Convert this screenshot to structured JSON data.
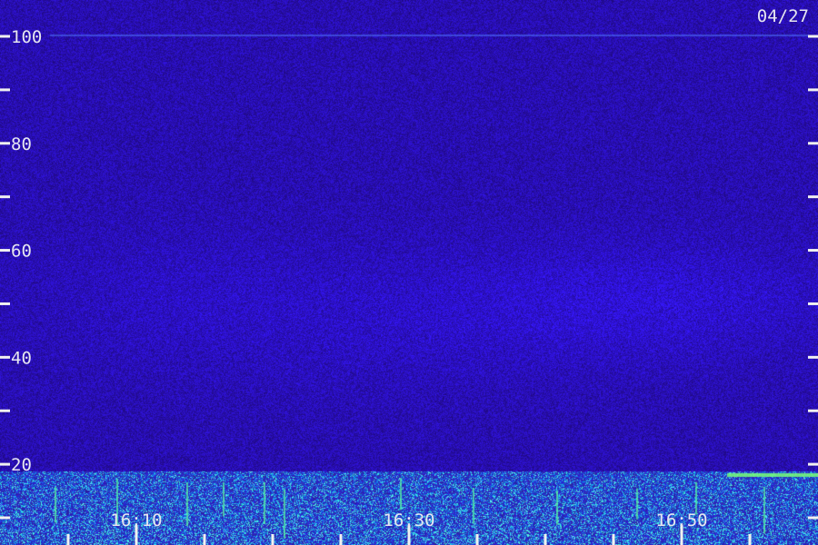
{
  "chart_data": {
    "type": "heatmap",
    "date_label": "04/27",
    "y_ticks": [
      20,
      40,
      60,
      80,
      100
    ],
    "y_minor_ticks": [
      10,
      30,
      50,
      70,
      90
    ],
    "x_tick_labels": [
      "16:10",
      "16:30",
      "16:50"
    ],
    "ylim": [
      10,
      100
    ],
    "colors": {
      "background": "#2a0a6e",
      "high_intensity": "#3cff9a",
      "mid_intensity": "#1e6cff",
      "text": "#e6e6f0"
    }
  }
}
